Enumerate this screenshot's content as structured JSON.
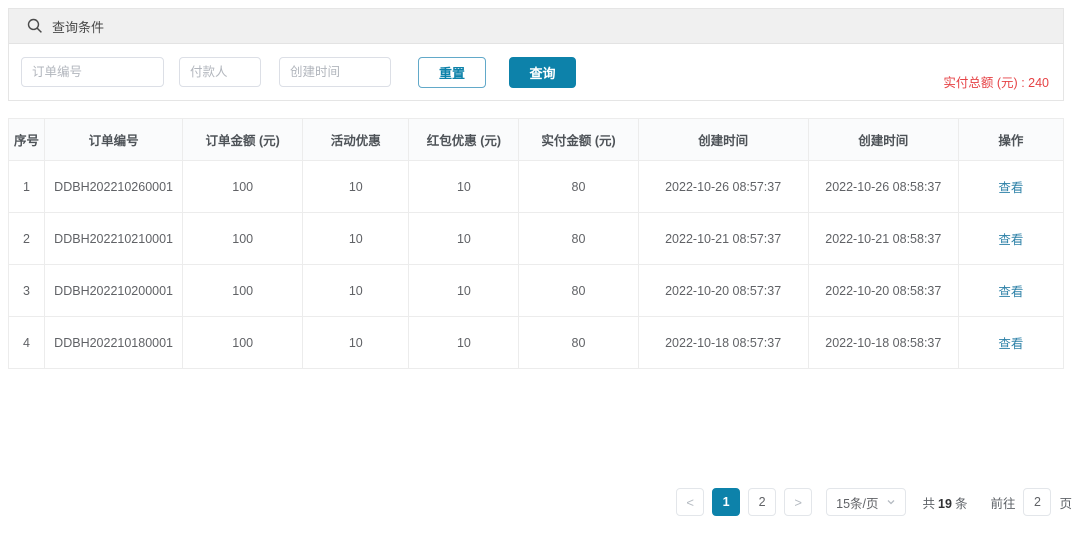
{
  "search_panel": {
    "title": "查询条件",
    "inputs": [
      {
        "placeholder": "订单编号"
      },
      {
        "placeholder": "付款人"
      },
      {
        "placeholder": "创建时间"
      }
    ],
    "reset_label": "重置",
    "query_label": "查询",
    "total_paid_label": "实付总额 (元) : 240"
  },
  "table": {
    "columns": [
      "序号",
      "订单编号",
      "订单金额 (元)",
      "活动优惠",
      "红包优惠 (元)",
      "实付金额 (元)",
      "创建时间",
      "创建时间",
      "操作"
    ],
    "rows": [
      {
        "cells": [
          "1",
          "DDBH202210260001",
          "100",
          "10",
          "10",
          "80",
          "2022-10-26 08:57:37",
          "2022-10-26 08:58:37"
        ],
        "action": "查看"
      },
      {
        "cells": [
          "2",
          "DDBH202210210001",
          "100",
          "10",
          "10",
          "80",
          "2022-10-21 08:57:37",
          "2022-10-21 08:58:37"
        ],
        "action": "查看"
      },
      {
        "cells": [
          "3",
          "DDBH202210200001",
          "100",
          "10",
          "10",
          "80",
          "2022-10-20 08:57:37",
          "2022-10-20 08:58:37"
        ],
        "action": "查看"
      },
      {
        "cells": [
          "4",
          "DDBH202210180001",
          "100",
          "10",
          "10",
          "80",
          "2022-10-18 08:57:37",
          "2022-10-18 08:58:37"
        ],
        "action": "查看"
      }
    ]
  },
  "pagination": {
    "prev_icon": "<",
    "next_icon": ">",
    "pages": [
      "1",
      "2"
    ],
    "active_page": "1",
    "page_size_label": "15条/页",
    "total_prefix": "共",
    "total_count": "19",
    "total_suffix": "条",
    "goto_label": "前往",
    "goto_value": "2",
    "goto_suffix": "页"
  },
  "colors": {
    "primary": "#0d82aa",
    "danger_text": "#e64245",
    "link": "#2f82a8",
    "panel_header_bg": "#f0f0f0",
    "table_header_bg": "#fafbfc",
    "border": "#e5e5e5"
  }
}
